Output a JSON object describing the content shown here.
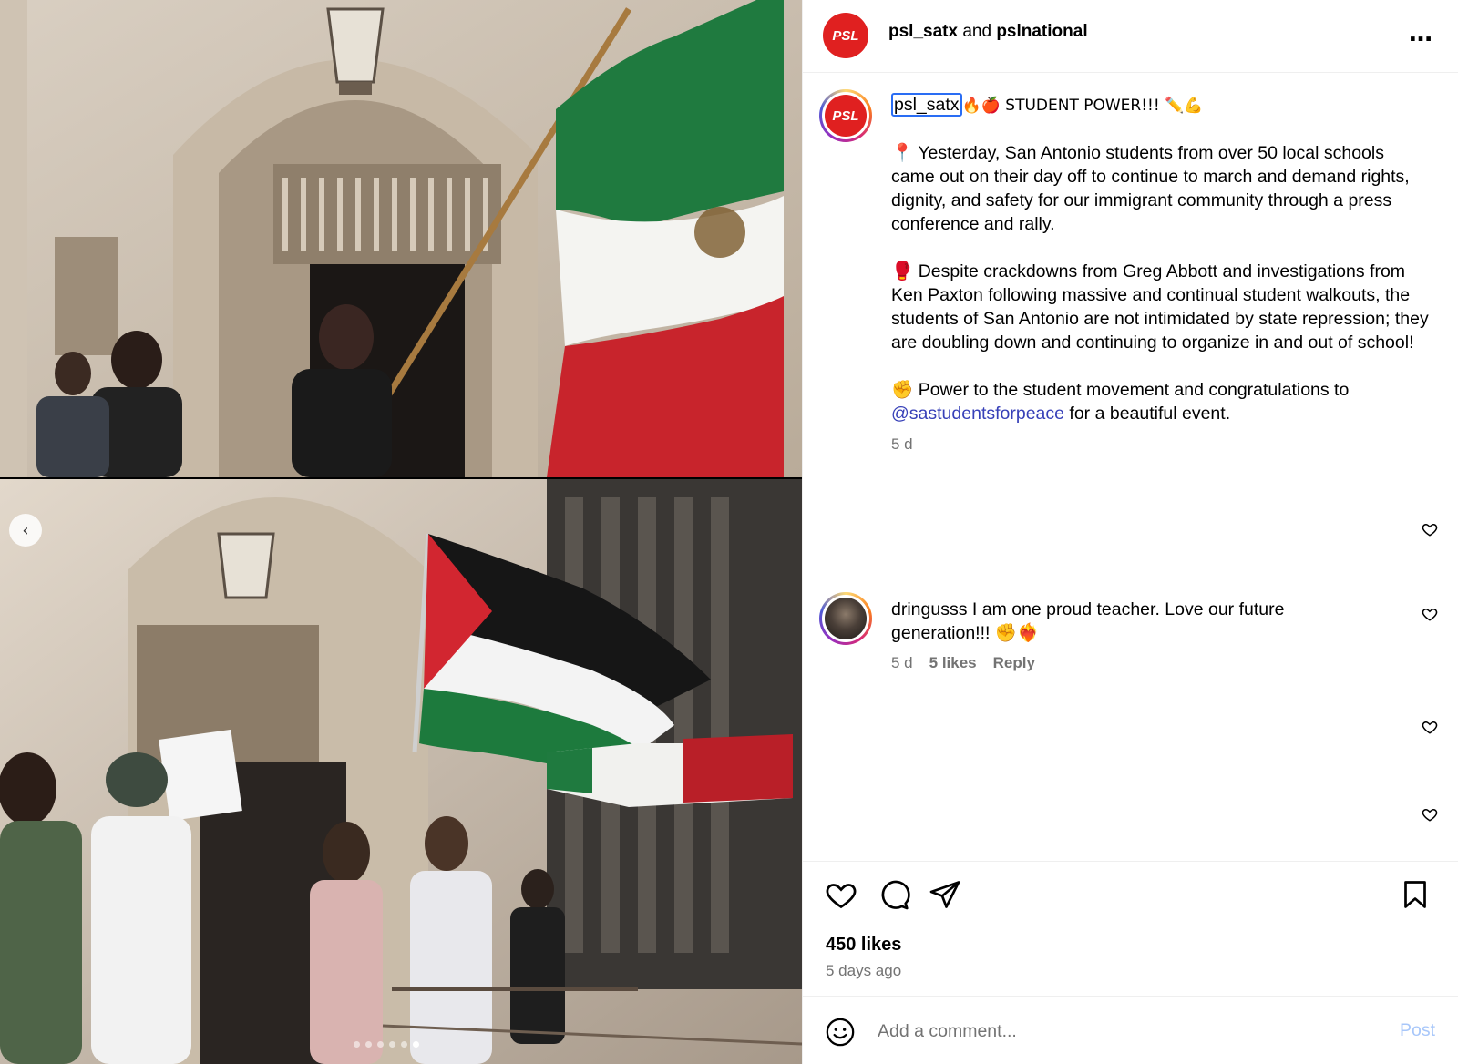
{
  "header": {
    "account_primary": "psl_satx",
    "joiner": "and",
    "account_secondary": "pslnational",
    "more_icon": "more-horizontal-icon"
  },
  "avatar": {
    "logo_text": "PSL"
  },
  "caption": {
    "username": "psl_satx",
    "headline": "🔥🍎 STUDENT POWER!!! ✏️💪",
    "p1": "📍 Yesterday, San Antonio students from over 50 local schools came out on their day off to continue to march and demand rights, dignity, and safety for our immigrant community through a press conference and rally.",
    "p2": "🥊 Despite crackdowns from Greg Abbott and investigations from Ken Paxton following massive and continual student walkouts, the students of San Antonio are not intimidated by state repression; they are doubling down and continuing to organize in and out of school!",
    "p3_before": "✊ Power to the student movement and congratulations to ",
    "p3_mention": "@sastudentsforpeace",
    "p3_after": " for a beautiful event.",
    "time": "5 d"
  },
  "comment": {
    "username": "dringusss",
    "text": "I am one proud teacher. Love our future generation!!! ✊❤️‍🔥",
    "time": "5 d",
    "likes": "5 likes",
    "reply": "Reply"
  },
  "stats": {
    "likes": "450 likes",
    "ago": "5 days ago"
  },
  "add_comment": {
    "placeholder": "Add a comment...",
    "post_label": "Post"
  },
  "carousel": {
    "prev_icon": "chevron-left-icon",
    "slide_count": 6,
    "active_index": 5
  },
  "colors": {
    "mention": "#3740b8",
    "post_disabled": "#a8c7fa",
    "psl_red": "#e02020",
    "muted": "#737373"
  }
}
